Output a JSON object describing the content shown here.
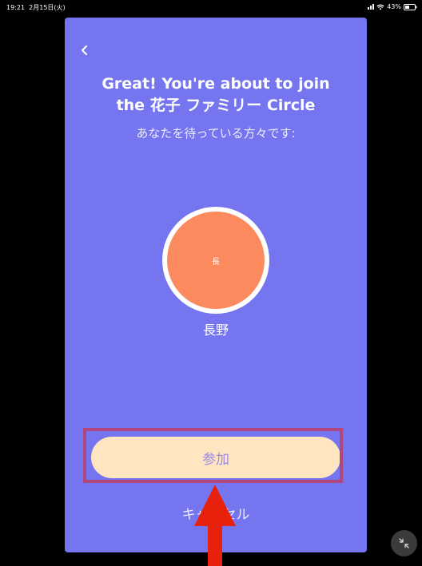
{
  "status_bar": {
    "time": "19:21",
    "date": "2月15日(火)",
    "battery": "43%"
  },
  "dialog": {
    "title_line1": "Great! You're about to join",
    "title_line2": "the 花子 ファミリー Circle",
    "subtitle": "あなたを待っている方々です:",
    "member": {
      "initial": "長",
      "name": "長野",
      "color": "#fb8a5f"
    },
    "join_label": "参加",
    "cancel_label": "キャンセル"
  },
  "colors": {
    "card_background": "#7575f0",
    "join_button_background": "#ffe5c0",
    "annotation": "#e8210c",
    "highlight_border": "#b0477f"
  }
}
